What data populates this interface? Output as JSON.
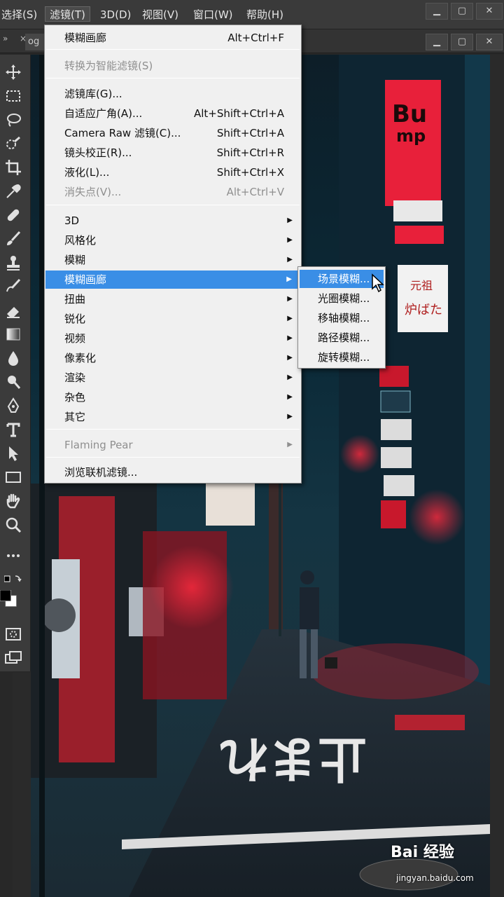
{
  "menubar": {
    "items": [
      "选择(S)",
      "滤镜(T)",
      "3D(D)",
      "视图(V)",
      "窗口(W)",
      "帮助(H)"
    ],
    "window_controls": [
      "minimize",
      "restore",
      "close"
    ]
  },
  "optrow": {
    "collapse": "»",
    "close": "×",
    "doc_tab": "og"
  },
  "filter_menu": {
    "last_filter": {
      "label": "模糊画廊",
      "shortcut": "Alt+Ctrl+F"
    },
    "smart": {
      "label": "转换为智能滤镜(S)"
    },
    "group1": [
      {
        "label": "滤镜库(G)...",
        "shortcut": ""
      },
      {
        "label": "自适应广角(A)...",
        "shortcut": "Alt+Shift+Ctrl+A"
      },
      {
        "label": "Camera Raw 滤镜(C)...",
        "shortcut": "Shift+Ctrl+A"
      },
      {
        "label": "镜头校正(R)...",
        "shortcut": "Shift+Ctrl+R"
      },
      {
        "label": "液化(L)...",
        "shortcut": "Shift+Ctrl+X"
      },
      {
        "label": "消失点(V)...",
        "shortcut": "Alt+Ctrl+V"
      }
    ],
    "submenus": [
      "3D",
      "风格化",
      "模糊",
      "模糊画廊",
      "扭曲",
      "锐化",
      "视频",
      "像素化",
      "渲染",
      "杂色",
      "其它"
    ],
    "plugin": "Flaming Pear",
    "browse": "浏览联机滤镜..."
  },
  "blur_gallery_submenu": [
    "场景模糊...",
    "光圈模糊...",
    "移轴模糊...",
    "路径模糊...",
    "旋转模糊..."
  ],
  "tools": [
    "move-icon",
    "marquee-icon",
    "lasso-icon",
    "quick-select-icon",
    "crop-icon",
    "eyedropper-icon",
    "healing-icon",
    "brush-icon",
    "stamp-icon",
    "history-brush-icon",
    "eraser-icon",
    "gradient-icon",
    "blur-drop-icon",
    "dodge-icon",
    "pen-icon",
    "type-icon",
    "path-select-icon",
    "rectangle-icon",
    "hand-icon",
    "zoom-icon",
    "more-icon",
    "swap-colors-icon",
    "foreground-color",
    "quick-mask-icon",
    "screen-mode-icon"
  ],
  "photo": {
    "sign_text": "元祖",
    "sign_text2": "炉ばた",
    "road_text": "止まれ"
  },
  "watermark": {
    "brand": "Bai 经验",
    "url": "jingyan.baidu.com"
  },
  "colors": {
    "highlight": "#3a8ee6",
    "menu_bg": "#f0f0f0",
    "ui_dark": "#3a3a3a",
    "neon_red": "#e8203a"
  }
}
